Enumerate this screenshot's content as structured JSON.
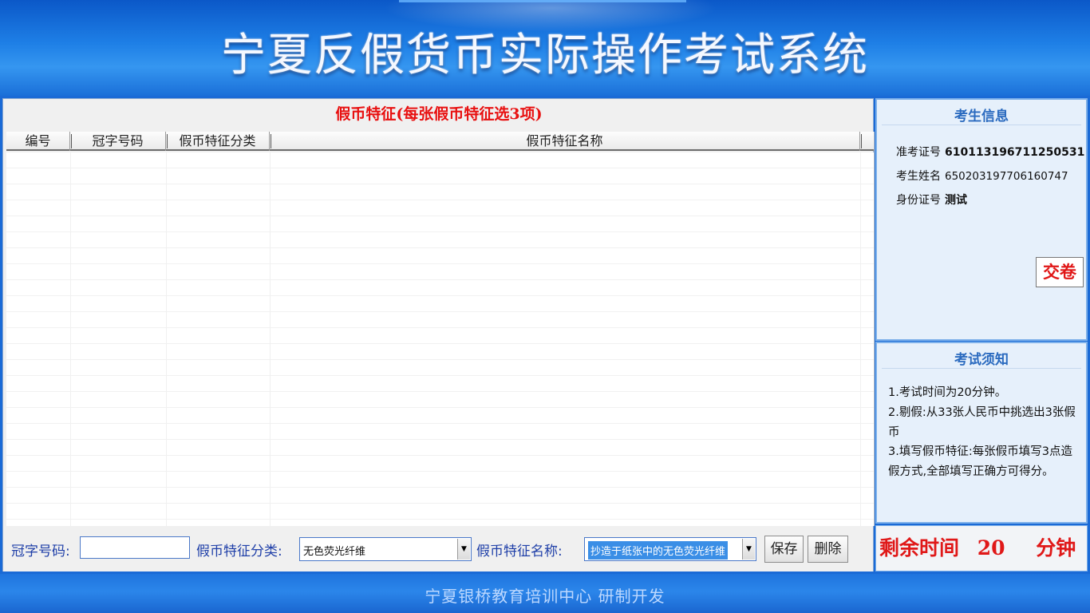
{
  "app": {
    "title": "宁夏反假货币实际操作考试系统",
    "footer": "宁夏银桥教育培训中心  研制开发"
  },
  "main": {
    "panel_title": "假币特征(每张假币特征选3项)",
    "columns": [
      "编号",
      "冠字号码",
      "假币特征分类",
      "假币特征名称"
    ],
    "rows": []
  },
  "form": {
    "serial_label": "冠字号码:",
    "serial_value": "",
    "category_label": "假币特征分类:",
    "category_selected": "无色荧光纤维",
    "name_label": "假币特征名称:",
    "name_selected": "抄造于纸张中的无色荧光纤维",
    "save_label": "保存",
    "delete_label": "删除"
  },
  "candidate": {
    "title": "考生信息",
    "exam_id_label": "准考证号",
    "exam_id": "610113196711250531",
    "name_label": "考生姓名",
    "name": "650203197706160747",
    "id_card_label": "身份证号",
    "id_card": "测试",
    "submit_label": "交卷"
  },
  "notice": {
    "title": "考试须知",
    "items": [
      "1.考试时间为20分钟。",
      "2.剔假:从33张人民币中挑选出3张假币",
      "3.填写假币特征:每张假币填写3点造假方式,全部填写正确方可得分。"
    ]
  },
  "timer": {
    "label": "剩余时间",
    "value": "20",
    "unit": "分钟"
  },
  "colors": {
    "accent_red": "#e81010",
    "banner_blue": "#1e7fe6",
    "label_blue": "#1f3fa8"
  }
}
